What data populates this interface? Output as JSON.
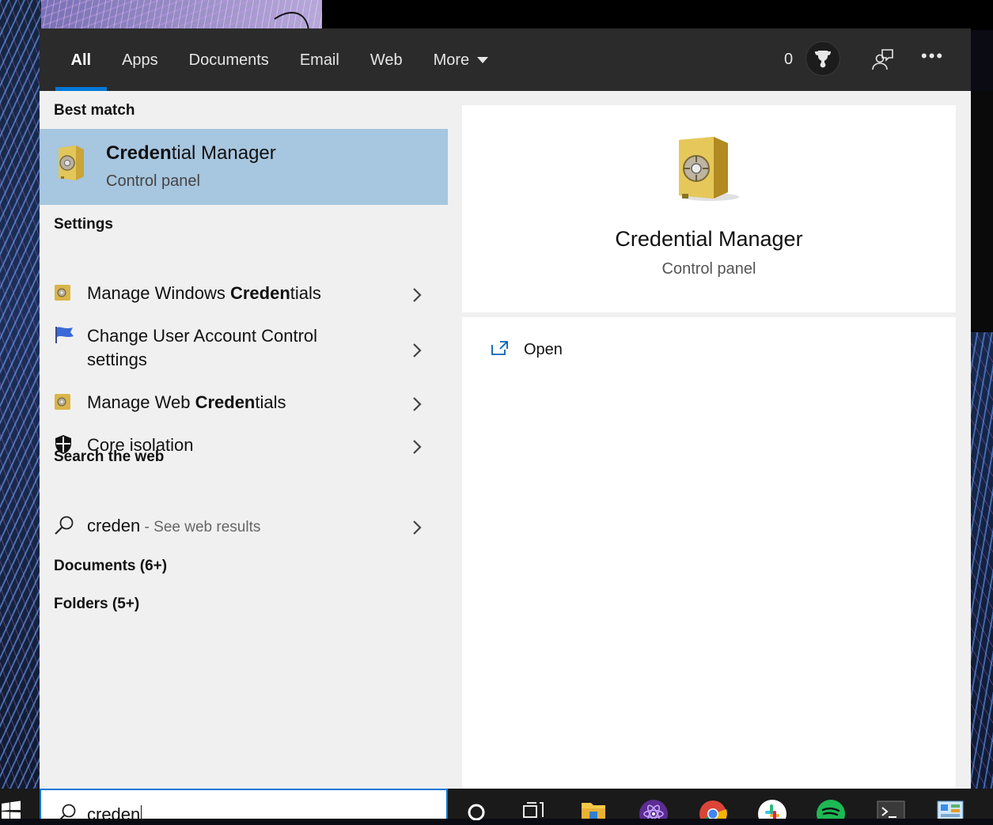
{
  "tabs": [
    {
      "label": "All",
      "active": true
    },
    {
      "label": "Apps"
    },
    {
      "label": "Documents"
    },
    {
      "label": "Email"
    },
    {
      "label": "Web"
    },
    {
      "label": "More"
    }
  ],
  "header": {
    "points": "0",
    "icons": [
      "trophy-icon",
      "feedback-icon",
      "more-options-icon"
    ]
  },
  "left": {
    "best_match_header": "Best match",
    "best_match": {
      "title_bold": "Creden",
      "title_rest": "tial Manager",
      "subtitle": "Control panel",
      "icon": "safe-icon"
    },
    "settings_header": "Settings",
    "settings": [
      {
        "pre": "Manage Windows ",
        "bold": "Creden",
        "post": "tials",
        "icon": "safe-icon"
      },
      {
        "line1": "Change User Account Control",
        "line2": "settings",
        "icon": "flag-icon"
      },
      {
        "pre": "Manage Web ",
        "bold": "Creden",
        "post": "tials",
        "icon": "safe-icon"
      },
      {
        "label": "Core isolation",
        "icon": "shield-icon"
      }
    ],
    "web_header": "Search the web",
    "web_result": {
      "query": "creden",
      "hint": " - See web results"
    },
    "documents": "Documents (6+)",
    "folders": "Folders (5+)"
  },
  "preview": {
    "title": "Credential Manager",
    "subtitle": "Control panel",
    "actions": [
      {
        "label": "Open",
        "icon": "open-external-icon"
      }
    ]
  },
  "taskbar": {
    "search_value": "creden",
    "apps": [
      "cortana-icon",
      "task-view-icon",
      "file-explorer-icon",
      "atom-icon",
      "chrome-icon",
      "slack-icon",
      "spotify-icon",
      "terminal-icon",
      "control-panel-icon"
    ],
    "colors": {
      "accent": "#0078d7",
      "selection": "#a7c6df",
      "topbar": "#2b2b2b",
      "panel": "#f0f0f0"
    }
  }
}
